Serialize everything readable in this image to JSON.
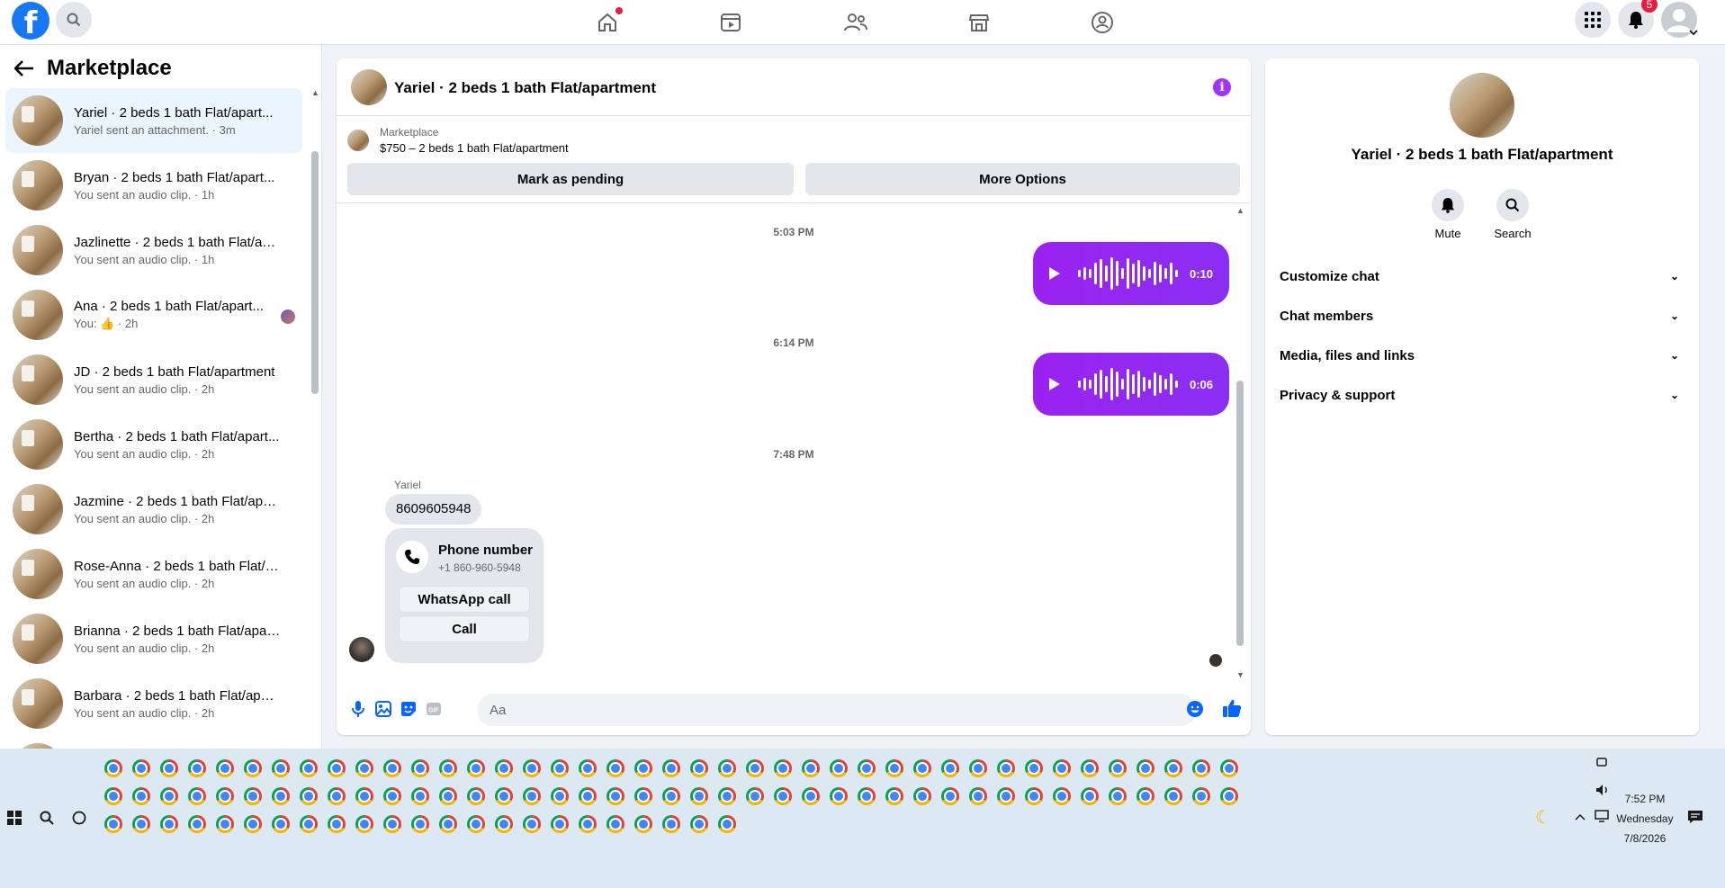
{
  "topbar": {
    "logo": "f",
    "notifications_count": "5"
  },
  "sidebar": {
    "title": "Marketplace",
    "conversations": [
      {
        "name": "Yariel · 2 beds 1 bath Flat/apart...",
        "sub": "Yariel sent an attachment. · 3m",
        "active": true
      },
      {
        "name": "Bryan · 2 beds 1 bath Flat/apart...",
        "sub": "You sent an audio clip. · 1h"
      },
      {
        "name": "Jazlinette · 2 beds 1 bath Flat/ap...",
        "sub": "You sent an audio clip. · 1h"
      },
      {
        "name": "Ana · 2 beds 1 bath Flat/apart...",
        "sub_prefix": "You: ",
        "sub_suffix": " · 2h"
      },
      {
        "name": "JD · 2 beds 1 bath Flat/apartment",
        "sub": "You sent an audio clip. · 2h"
      },
      {
        "name": "Bertha · 2 beds 1 bath Flat/apart...",
        "sub": "You sent an audio clip. · 2h"
      },
      {
        "name": "Jazmine · 2 beds 1 bath Flat/apa...",
        "sub": "You sent an audio clip. · 2h"
      },
      {
        "name": "Rose-Anna · 2 beds 1 bath Flat/a...",
        "sub": "You sent an audio clip. · 2h"
      },
      {
        "name": "Brianna · 2 beds 1 bath Flat/apar...",
        "sub": "You sent an audio clip. · 2h"
      },
      {
        "name": "Barbara · 2 beds 1 bath Flat/apar...",
        "sub": "You sent an audio clip. · 2h"
      }
    ]
  },
  "chat": {
    "title": "Yariel · 2 beds 1 bath Flat/apartment",
    "marketplace_label": "Marketplace",
    "listing": "$750 – 2 beds 1 bath Flat/apartment",
    "mark_pending": "Mark as pending",
    "more_options": "More Options",
    "messages": {
      "ts1": "5:03 PM",
      "audio1_duration": "0:10",
      "ts2": "6:14 PM",
      "audio2_duration": "0:06",
      "ts3": "7:48 PM",
      "sender": "Yariel",
      "text": "8609605948",
      "phone_title": "Phone number",
      "phone_number": "+1 860-960-5948",
      "whatsapp_call": "WhatsApp call",
      "call": "Call"
    },
    "composer_placeholder": "Aa"
  },
  "right_panel": {
    "name": "Yariel · 2 beds 1 bath Flat/apartment",
    "mute": "Mute",
    "search": "Search",
    "rows": [
      "Customize chat",
      "Chat members",
      "Media, files and links",
      "Privacy & support"
    ]
  },
  "taskbar": {
    "time": "7:52 PM",
    "day": "Wednesday",
    "date": "7/8/2026"
  },
  "colors": {
    "brand": "#1877f2",
    "audio_bubble": "#9b22f0",
    "info": "#a033ff"
  }
}
